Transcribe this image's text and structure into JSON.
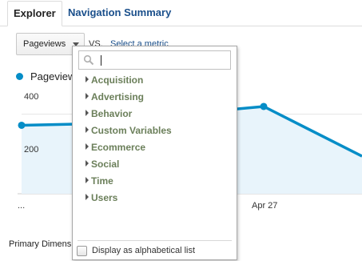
{
  "tabs": [
    {
      "label": "Explorer",
      "active": true
    },
    {
      "label": "Navigation Summary",
      "active": false
    }
  ],
  "metric_bar": {
    "selected_metric": "Pageviews",
    "vs_label": "VS.",
    "select_metric_link": "Select a metric"
  },
  "legend": {
    "label": "Pageviews",
    "color": "#058dc7"
  },
  "chart_data": {
    "type": "area",
    "series": [
      {
        "name": "Pageviews",
        "color": "#058dc7",
        "values": [
          310,
          315,
          350,
          370,
          395,
          170
        ]
      }
    ],
    "x_ticks": [
      "...",
      "Apr 27"
    ],
    "y_ticks": [
      400,
      200
    ],
    "ylim": [
      0,
      500
    ],
    "grid": true
  },
  "primary_dimension_label": "Primary Dimensi",
  "dropdown": {
    "search_placeholder": "",
    "items": [
      "Acquisition",
      "Advertising",
      "Behavior",
      "Custom Variables",
      "Ecommerce",
      "Social",
      "Time",
      "Users"
    ],
    "checkbox_label": "Display as alphabetical list",
    "checkbox_checked": false
  },
  "colors": {
    "link": "#1a4f8b",
    "category_text": "#6b7f5a",
    "area_fill": "#e8f4fb",
    "line": "#058dc7"
  }
}
